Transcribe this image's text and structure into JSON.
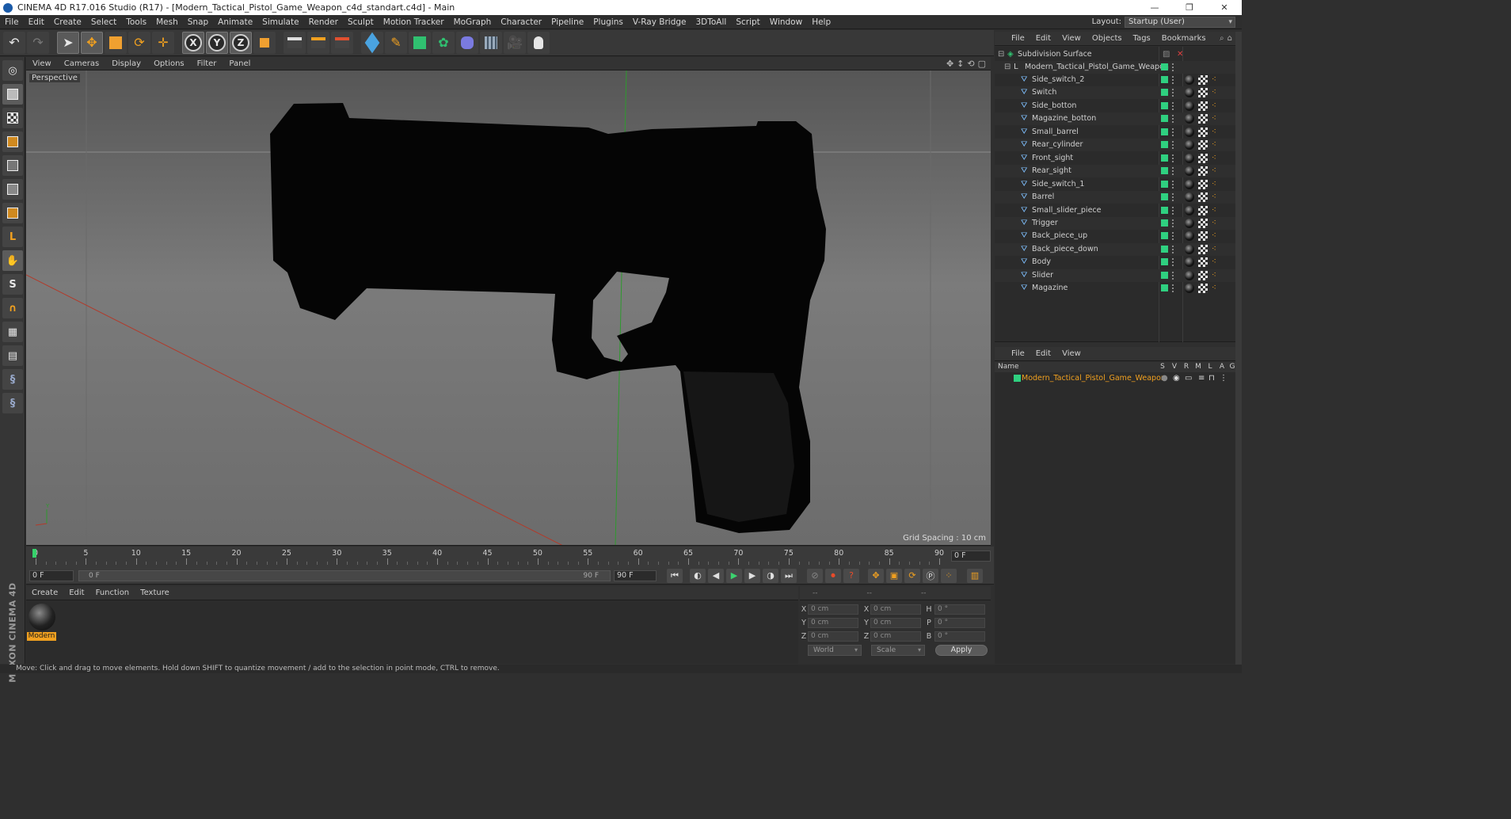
{
  "window": {
    "title": "CINEMA 4D R17.016 Studio (R17) - [Modern_Tactical_Pistol_Game_Weapon_c4d_standart.c4d] - Main",
    "minimize": "—",
    "maximize": "❐",
    "close": "✕"
  },
  "menubar": {
    "items": [
      "File",
      "Edit",
      "Create",
      "Select",
      "Tools",
      "Mesh",
      "Snap",
      "Animate",
      "Simulate",
      "Render",
      "Sculpt",
      "Motion Tracker",
      "MoGraph",
      "Character",
      "Pipeline",
      "Plugins",
      "V-Ray Bridge",
      "3DToAll",
      "Script",
      "Window",
      "Help"
    ],
    "layout_label": "Layout:",
    "layout_value": "Startup (User)"
  },
  "toolbar": {
    "axis_x": "X",
    "axis_y": "Y",
    "axis_z": "Z"
  },
  "viewport": {
    "menu": [
      "View",
      "Cameras",
      "Display",
      "Options",
      "Filter",
      "Panel"
    ],
    "label": "Perspective",
    "grid_spacing": "Grid Spacing : 10 cm"
  },
  "timeline": {
    "ticks": [
      "0",
      "5",
      "10",
      "15",
      "20",
      "25",
      "30",
      "35",
      "40",
      "45",
      "50",
      "55",
      "60",
      "65",
      "70",
      "75",
      "80",
      "85",
      "90"
    ],
    "current_frame": "0 F"
  },
  "transport": {
    "start_frame": "0 F",
    "range_start": "0 F",
    "range_end": "90 F",
    "end_frame": "90 F"
  },
  "material_manager": {
    "menu": [
      "Create",
      "Edit",
      "Function",
      "Texture"
    ],
    "material_name": "Modern"
  },
  "coordinates": {
    "headers": [
      "--",
      "--",
      "--"
    ],
    "rows": [
      {
        "pos_axis": "X",
        "pos_value": "0 cm",
        "size_axis": "X",
        "size_value": "0 cm",
        "rot_axis": "H",
        "rot_value": "0 °"
      },
      {
        "pos_axis": "Y",
        "pos_value": "0 cm",
        "size_axis": "Y",
        "size_value": "0 cm",
        "rot_axis": "P",
        "rot_value": "0 °"
      },
      {
        "pos_axis": "Z",
        "pos_value": "0 cm",
        "size_axis": "Z",
        "size_value": "0 cm",
        "rot_axis": "B",
        "rot_value": "0 °"
      }
    ],
    "mode_select": "World",
    "transform_select": "Scale",
    "apply_label": "Apply"
  },
  "object_manager": {
    "menu": [
      "File",
      "Edit",
      "View",
      "Objects",
      "Tags",
      "Bookmarks"
    ],
    "root": "Subdivision Surface",
    "group": "Modern_Tactical_Pistol_Game_Weapon",
    "children": [
      "Side_switch_2",
      "Switch",
      "Side_botton",
      "Magazine_botton",
      "Small_barrel",
      "Rear_cylinder",
      "Front_sight",
      "Rear_sight",
      "Side_switch_1",
      "Barrel",
      "Small_slider_piece",
      "Trigger",
      "Back_piece_up",
      "Back_piece_down",
      "Body",
      "Slider",
      "Magazine"
    ]
  },
  "layer_manager": {
    "menu": [
      "File",
      "Edit",
      "View"
    ],
    "columns": [
      "Name",
      "S",
      "V",
      "R",
      "M",
      "L",
      "A",
      "G"
    ],
    "layer_name": "Modern_Tactical_Pistol_Game_Weapon"
  },
  "statusbar": {
    "text": "Move: Click and drag to move elements. Hold down SHIFT to quantize movement / add to the selection in point mode, CTRL to remove."
  },
  "branding": {
    "logo": "MAXON CINEMA 4D"
  },
  "colors": {
    "accent_orange": "#f0a020",
    "visibility_green": "#2fd080",
    "play_green": "#3cd36f",
    "axis_red": "#c83a2a",
    "axis_green": "#2e9a2e"
  }
}
